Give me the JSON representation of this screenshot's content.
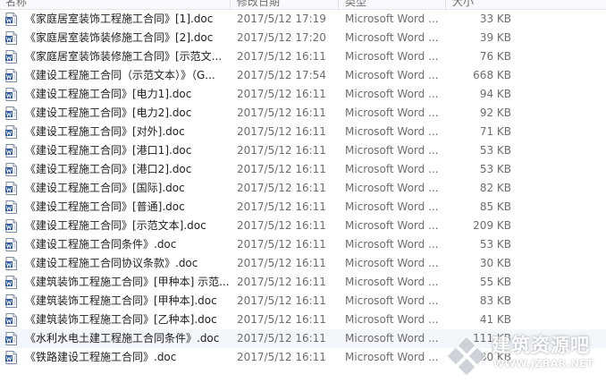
{
  "columns": {
    "name": "名称",
    "date": "修改日期",
    "type": "类型",
    "size": "大小"
  },
  "files": [
    {
      "name": "《家庭居室装饰工程施工合同》[1].doc",
      "date": "2017/5/12 17:19",
      "type": "Microsoft Word ...",
      "size": "33 KB"
    },
    {
      "name": "《家庭居室装饰装修施工合同》[2].doc",
      "date": "2017/5/12 17:20",
      "type": "Microsoft Word ...",
      "size": "39 KB"
    },
    {
      "name": "《家庭居室装饰装修施工合同》[示范文...",
      "date": "2017/5/12 16:11",
      "type": "Microsoft Word ...",
      "size": "76 KB"
    },
    {
      "name": "《建设工程施工合同（示范文本）》（G...",
      "date": "2017/5/12 17:54",
      "type": "Microsoft Word ...",
      "size": "668 KB"
    },
    {
      "name": "《建设工程施工合同》[电力1].doc",
      "date": "2017/5/12 16:11",
      "type": "Microsoft Word ...",
      "size": "94 KB"
    },
    {
      "name": "《建设工程施工合同》[电力2].doc",
      "date": "2017/5/12 16:11",
      "type": "Microsoft Word ...",
      "size": "92 KB"
    },
    {
      "name": "《建设工程施工合同》[对外].doc",
      "date": "2017/5/12 16:11",
      "type": "Microsoft Word ...",
      "size": "71 KB"
    },
    {
      "name": "《建设工程施工合同》[港口1].doc",
      "date": "2017/5/12 16:11",
      "type": "Microsoft Word ...",
      "size": "53 KB"
    },
    {
      "name": "《建设工程施工合同》[港口2].doc",
      "date": "2017/5/12 16:11",
      "type": "Microsoft Word ...",
      "size": "53 KB"
    },
    {
      "name": "《建设工程施工合同》[国际].doc",
      "date": "2017/5/12 16:11",
      "type": "Microsoft Word ...",
      "size": "82 KB"
    },
    {
      "name": "《建设工程施工合同》[普通].doc",
      "date": "2017/5/12 16:11",
      "type": "Microsoft Word ...",
      "size": "85 KB"
    },
    {
      "name": "《建设工程施工合同》[示范文本].doc",
      "date": "2017/5/12 16:11",
      "type": "Microsoft Word ...",
      "size": "209 KB"
    },
    {
      "name": "《建设工程施工合同条件》.doc",
      "date": "2017/5/12 16:11",
      "type": "Microsoft Word ...",
      "size": "53 KB"
    },
    {
      "name": "《建设工程施工合同协议条款》.doc",
      "date": "2017/5/12 16:11",
      "type": "Microsoft Word ...",
      "size": "30 KB"
    },
    {
      "name": "《建筑装饰工程施工合同》[甲种本] 示范...",
      "date": "2017/5/12 16:11",
      "type": "Microsoft Word ...",
      "size": "55 KB"
    },
    {
      "name": "《建筑装饰工程施工合同》[甲种本].doc",
      "date": "2017/5/12 16:11",
      "type": "Microsoft Word ...",
      "size": "83 KB"
    },
    {
      "name": "《建筑装饰工程施工合同》[乙种本].doc",
      "date": "2017/5/12 16:11",
      "type": "Microsoft Word ...",
      "size": "41 KB"
    },
    {
      "name": "《水利水电土建工程施工合同条件》.doc",
      "date": "2017/5/12 16:11",
      "type": "Microsoft Word ...",
      "size": "111 KB"
    },
    {
      "name": "《铁路建设工程施工合同》.doc",
      "date": "2017/5/12 16:11",
      "type": "Microsoft Word ...",
      "size": "80 KB"
    }
  ],
  "selected_index": 17,
  "watermark": {
    "title": "建筑资源吧",
    "url": "WWW.JZBAR.NET"
  },
  "colors": {
    "selection": "#f3f6fb",
    "word_icon": "#2b579a"
  },
  "icons": {
    "file": "word-document-icon"
  }
}
